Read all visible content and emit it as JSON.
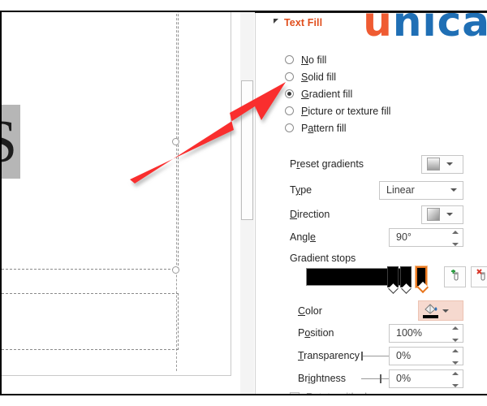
{
  "app": {
    "pane_title": "Text Fill",
    "watermark": {
      "first_letter": "u",
      "rest": "nica"
    }
  },
  "canvas": {
    "selected_text_fragment": "S",
    "handle_names": [
      "middle-right-handle",
      "bottom-right-handle"
    ]
  },
  "fill_options": [
    {
      "label_prefix": "",
      "accel": "N",
      "label_suffix": "o fill",
      "selected": false,
      "name": "no-fill"
    },
    {
      "label_prefix": "",
      "accel": "S",
      "label_suffix": "olid fill",
      "selected": false,
      "name": "solid-fill"
    },
    {
      "label_prefix": "",
      "accel": "G",
      "label_suffix": "radient fill",
      "selected": true,
      "name": "gradient-fill"
    },
    {
      "label_prefix": "",
      "accel": "P",
      "label_suffix": "icture or texture fill",
      "selected": false,
      "name": "picture-or-texture-fill"
    },
    {
      "label_prefix": "P",
      "accel": "a",
      "label_suffix": "ttern fill",
      "selected": false,
      "name": "pattern-fill"
    }
  ],
  "controls": {
    "preset_gradients": {
      "label_prefix": "P",
      "accel": "r",
      "label_suffix": "eset gradients"
    },
    "type": {
      "label_prefix": "T",
      "accel": "y",
      "label_suffix": "pe",
      "value": "Linear"
    },
    "direction": {
      "label_prefix": "",
      "accel": "D",
      "label_suffix": "irection"
    },
    "angle": {
      "label_prefix": "Angl",
      "accel": "e",
      "label_suffix": "",
      "value": "90°"
    },
    "gradient_stops": {
      "label": "Gradient stops"
    },
    "color": {
      "label_prefix": "",
      "accel": "C",
      "label_suffix": "olor"
    },
    "position": {
      "label_prefix": "P",
      "accel": "o",
      "label_suffix": "sition",
      "value": "100%"
    },
    "transparency": {
      "label_prefix": "",
      "accel": "T",
      "label_suffix": "ransparency",
      "value": "0%",
      "slider_percent": 0
    },
    "brightness": {
      "label_prefix": "Br",
      "accel": "i",
      "label_suffix": "ghtness",
      "value": "0%",
      "slider_percent": 50
    },
    "rotate_with_shape": {
      "label_prefix": "Rotate ",
      "accel": "w",
      "label_suffix": "ith shape",
      "checked": true,
      "disabled": true
    }
  },
  "buttons": {
    "add_gradient_stop": "Add gradient stop",
    "remove_gradient_stop": "Remove gradient stop"
  },
  "colors": {
    "accent_orange": "#e04e1c",
    "logo_orange": "#ef5b32",
    "logo_blue": "#1f6fb5",
    "selected_stop_outline": "#e8771f",
    "annotation_arrow": "#f92f2f",
    "gradient_stop_color": "#000000"
  }
}
